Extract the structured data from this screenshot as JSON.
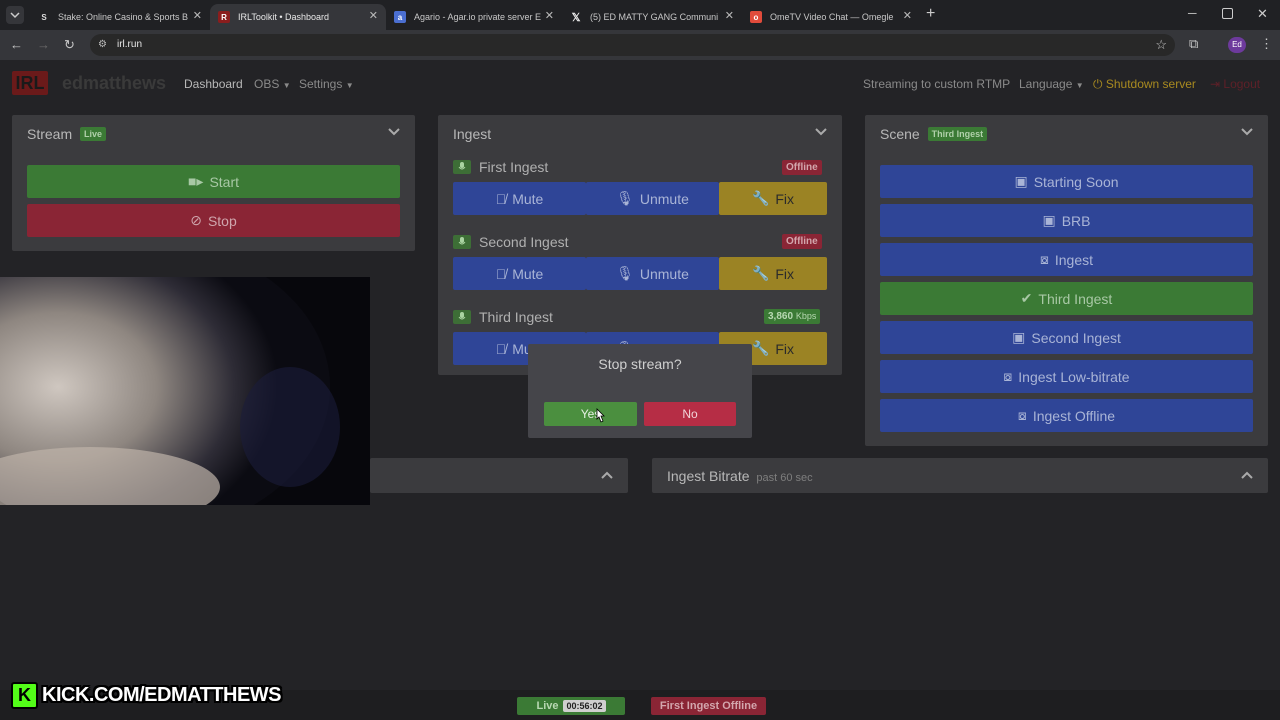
{
  "browser": {
    "tabs": [
      {
        "title": "Stake: Online Casino & Sports B",
        "icon": "stake-icon"
      },
      {
        "title": "IRLToolkit • Dashboard",
        "icon": "irltoolkit-icon",
        "active": true
      },
      {
        "title": "Agario - Agar.io private server E",
        "icon": "agario-icon"
      },
      {
        "title": "(5) ED MATTY GANG Communi",
        "icon": "x-icon"
      },
      {
        "title": "OmeTV Video Chat — Omegle",
        "icon": "ometv-icon"
      }
    ],
    "url": "irl.run",
    "profile": "Ed"
  },
  "header": {
    "logo": "IRL",
    "username": "edmatthews",
    "nav": {
      "dashboard": "Dashboard",
      "obs": "OBS",
      "settings": "Settings"
    },
    "streaming_status": "Streaming to custom RTMP",
    "language": "Language",
    "shutdown": "Shutdown server",
    "logout": "Logout"
  },
  "stream_panel": {
    "title": "Stream",
    "badge": "Live",
    "start_label": "Start",
    "stop_label": "Stop"
  },
  "ingest_panel": {
    "title": "Ingest",
    "ingests": [
      {
        "name": "First Ingest",
        "status": "Offline"
      },
      {
        "name": "Second Ingest",
        "status": "Offline"
      },
      {
        "name": "Third Ingest",
        "bitrate": "3,860",
        "unit": "Kbps"
      }
    ],
    "mute_label": "Mute",
    "unmute_label": "Unmute",
    "fix_label": "Fix"
  },
  "scene_panel": {
    "title": "Scene",
    "badge": "Third Ingest",
    "scenes": [
      "Starting Soon",
      "BRB",
      "Ingest",
      "Third Ingest",
      "Second Ingest",
      "Ingest Low-bitrate",
      "Ingest Offline"
    ],
    "active_scene": "Third Ingest"
  },
  "bitrate_panel": {
    "title": "Ingest Bitrate",
    "subtitle": "past 60 sec"
  },
  "modal": {
    "title": "Stop stream?",
    "yes": "Yes",
    "no": "No"
  },
  "bottom": {
    "live_label": "Live",
    "timer": "00:56:02",
    "ingest_status": "First Ingest Offline"
  },
  "overlay": {
    "kick_text": "KICK.COM/EDMATTHEWS"
  },
  "colors": {
    "blue": "#2f4597",
    "green": "#3b7a35",
    "red": "#8a2535",
    "yellow": "#9b8324",
    "kick_green": "#53fc18"
  }
}
